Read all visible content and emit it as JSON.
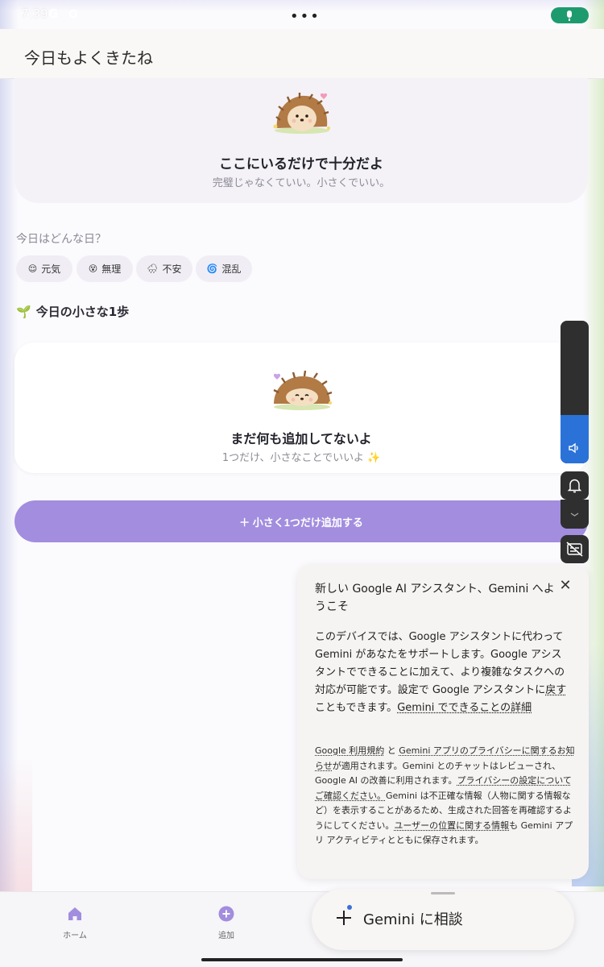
{
  "status_bar": {
    "time": "7:39",
    "g": "G",
    "more": "•••"
  },
  "app": {
    "title": "今日もよくきたね"
  },
  "hero": {
    "title": "ここにいるだけで十分だよ",
    "subtitle": "完璧じゃなくていい。小さくでいい。"
  },
  "mood": {
    "label": "今日はどんな日？",
    "options": [
      {
        "emoji": "😌",
        "label": "元気"
      },
      {
        "emoji": "😵",
        "label": "無理"
      },
      {
        "emoji": "🌧",
        "label": "不安"
      },
      {
        "emoji": "🌀",
        "label": "混乱"
      }
    ]
  },
  "steps": {
    "title_icon": "🌱",
    "title": "今日の小さな1歩",
    "empty_title": "まだ何も追加してないよ",
    "empty_subtitle": "1つだけ、小さなことでいいよ ✨",
    "add_button": "＋ 小さく1つだけ追加する"
  },
  "volume": {
    "level": 0.34
  },
  "gemini_card": {
    "title": "新しい Google AI アシスタント、Gemini へようこそ",
    "body_plain": "このデバイスでは、Google アシスタントに代わって Gemini があなたをサポートします。Google アシスタントでできることに加えて、より複雑なタスクへの対応が可能です。設定で Google アシスタントに",
    "body_link1": "戻す",
    "body_mid": "こともできます。",
    "body_link2": "Gemini でできることの詳細",
    "fine_link1": "Google 利用規約",
    "fine_and": "と",
    "fine_link2": "Gemini アプリのプライバシーに関するお知らせ",
    "fine_t1": "が適用されます。Gemini とのチャットはレビューされ、Google AI の改善に利用されます。",
    "fine_link3": "プライバシーの設定についてご確認ください。",
    "fine_t2": "Gemini は不正確な情報（人物に関する情報など）を表示することがあるため、生成された回答を再確認するようにしてください。",
    "fine_link4": "ユーザーの位置に関する情報",
    "fine_t3": "も Gemini アプリ アクティビティとともに保存されます。",
    "close": "✕"
  },
  "nav": {
    "home": "ホーム",
    "add": "追加"
  },
  "gemini_fab": {
    "label": "Gemini に相談"
  },
  "colors": {
    "accent": "#a28ddf",
    "volume": "#2a72d8",
    "mic": "#1e9b6e"
  }
}
